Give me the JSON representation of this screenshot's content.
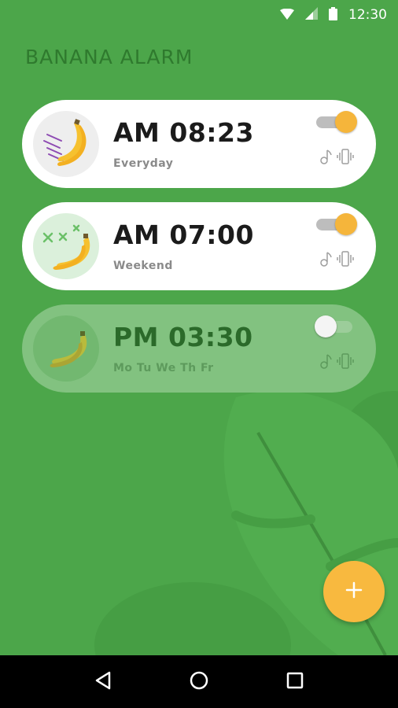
{
  "status_bar": {
    "time": "12:30",
    "icons": [
      "wifi-icon",
      "cell-signal-icon",
      "battery-icon"
    ]
  },
  "app": {
    "title": "BANANA ALARM"
  },
  "alarms": [
    {
      "time": "AM 08:23",
      "repeat": "Everyday",
      "enabled": true,
      "icon": "banana-motion-icon"
    },
    {
      "time": "AM 07:00",
      "repeat": "Weekend",
      "enabled": true,
      "icon": "banana-sparkle-icon"
    },
    {
      "time": "PM 03:30",
      "repeat": "Mo Tu We Th Fr",
      "enabled": false,
      "icon": "banana-icon"
    }
  ],
  "fab": {
    "label": "+",
    "icon": "plus-icon"
  },
  "nav_bar": {
    "icons": [
      "back-icon",
      "home-icon",
      "recents-icon"
    ]
  },
  "colors": {
    "background": "#4ca64a",
    "title": "#2f7a2e",
    "accent": "#f5b53b",
    "card": "#ffffff",
    "card_disabled": "#82c280"
  }
}
